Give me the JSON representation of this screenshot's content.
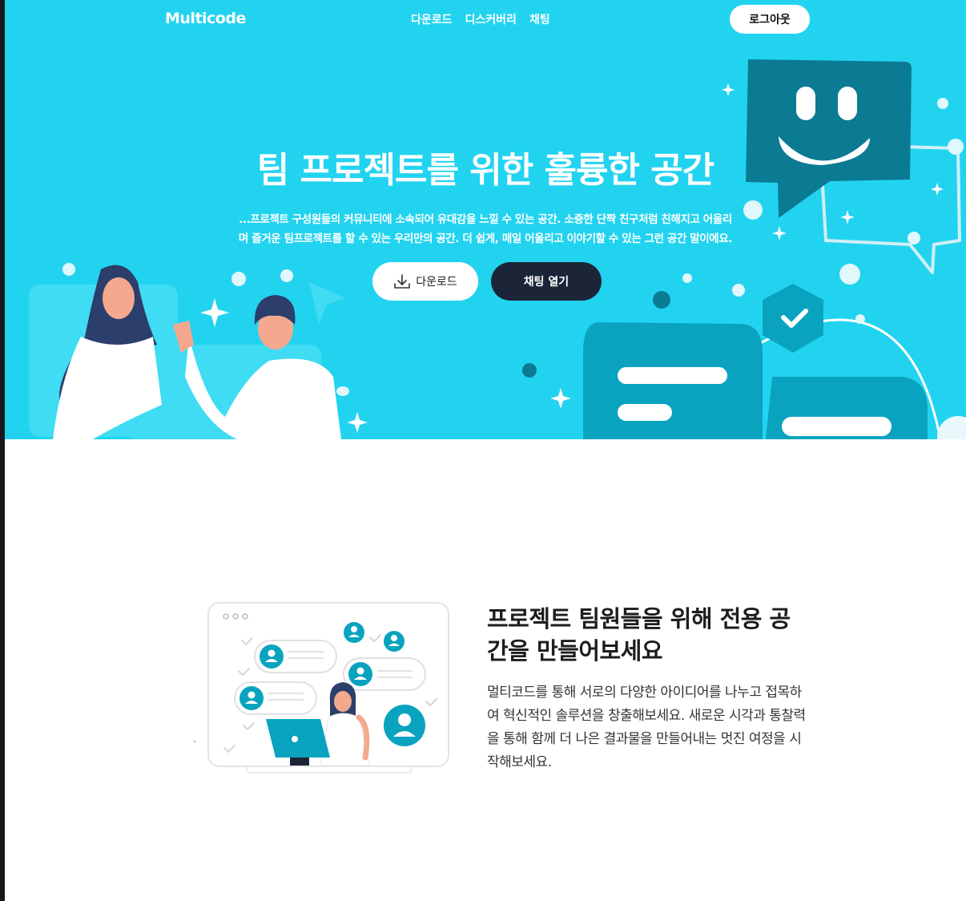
{
  "header": {
    "brand": "Multicode",
    "nav": [
      "다운로드",
      "디스커버리",
      "채팅"
    ],
    "logout_label": "로그아웃"
  },
  "hero": {
    "title": "팀 프로젝트를 위한 훌륭한 공간",
    "description_line1": "...프로젝트 구성원들의 커뮤니티에 소속되어 유대감을 느낄 수 있는 공간. 소중한 단짝 친구처럼 친해지고 어울리",
    "description_line2": "며 즐거운 팀프로젝트를 할 수 있는 우리만의 공간. 더 쉽게, 매일 어울리고 이야기할 수 있는 그런 공간 말이에요.",
    "download_label": "다운로드",
    "open_chat_label": "채팅 열기"
  },
  "feature": {
    "title": "프로젝트 팀원들을 위해 전용 공간을 만들어보세요",
    "body": "멀티코드를 통해 서로의 다양한 아이디어를 나누고 접목하여 혁신적인 솔루션을 창출해보세요. 새로운 시각과 통찰력을 통해 함께 더 나은 결과물을 만들어내는 멋진 여정을 시작해보세요."
  },
  "colors": {
    "hero_bg": "#22d3f0",
    "dark_button": "#1b2537",
    "teal": "#0aa3bf",
    "dark_teal": "#0b7a93"
  }
}
